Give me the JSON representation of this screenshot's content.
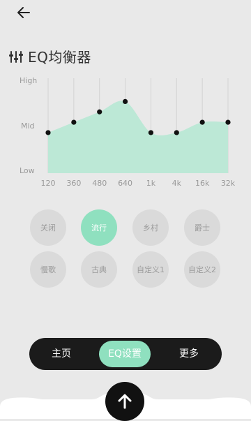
{
  "header": {
    "title": "EQ均衡器"
  },
  "chart_data": {
    "type": "area",
    "categories": [
      "120",
      "360",
      "480",
      "640",
      "1k",
      "4k",
      "16k",
      "32k"
    ],
    "values": [
      0.43,
      0.54,
      0.65,
      0.76,
      0.43,
      0.43,
      0.54,
      0.54
    ],
    "y_ticks": [
      "High",
      "Mid",
      "Low"
    ],
    "ylim": [
      0,
      1
    ],
    "grid": true,
    "fill_color": "#bce8d6",
    "point_color": "#111111"
  },
  "presets": [
    {
      "label": "关闭",
      "active": false
    },
    {
      "label": "流行",
      "active": true
    },
    {
      "label": "乡村",
      "active": false
    },
    {
      "label": "爵士",
      "active": false
    },
    {
      "label": "慢歌",
      "active": false
    },
    {
      "label": "古典",
      "active": false
    },
    {
      "label": "自定义1",
      "active": false
    },
    {
      "label": "自定义2",
      "active": false
    }
  ],
  "nav": {
    "items": [
      {
        "label": "主页",
        "active": false
      },
      {
        "label": "EQ设置",
        "active": true
      },
      {
        "label": "更多",
        "active": false
      }
    ]
  },
  "colors": {
    "accent": "#8fe0bf",
    "background": "#e9e9e9",
    "nav": "#1b1b1b"
  },
  "icons": {
    "back": "arrow-left-icon",
    "eq": "equalizer-icon",
    "fab": "arrow-up-icon"
  }
}
